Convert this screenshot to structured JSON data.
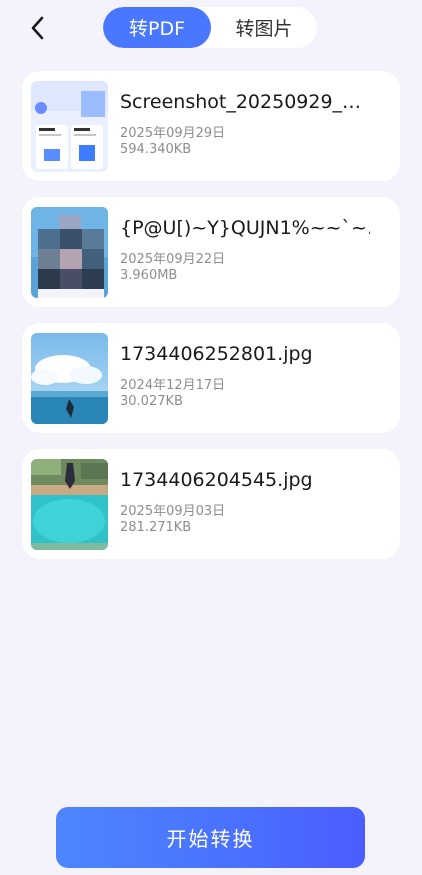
{
  "header": {
    "back_icon": "chevron-left-icon",
    "tabs": [
      {
        "label": "转PDF",
        "active": true
      },
      {
        "label": "转图片",
        "active": false
      }
    ]
  },
  "files": [
    {
      "name": "Screenshot_20250929_…",
      "date": "2025年09月29日",
      "size": "594.340KB"
    },
    {
      "name": "{P@U[)~Y}QUJN1%~~`~…",
      "date": "2025年09月22日",
      "size": "3.960MB"
    },
    {
      "name": "1734406252801.jpg",
      "date": "2024年12月17日",
      "size": "30.027KB"
    },
    {
      "name": "1734406204545.jpg",
      "date": "2025年09月03日",
      "size": "281.271KB"
    }
  ],
  "actions": {
    "start_label": "开始转换"
  },
  "colors": {
    "accent": "#4a77ff",
    "background": "#f4f3fb",
    "card": "#ffffff"
  }
}
